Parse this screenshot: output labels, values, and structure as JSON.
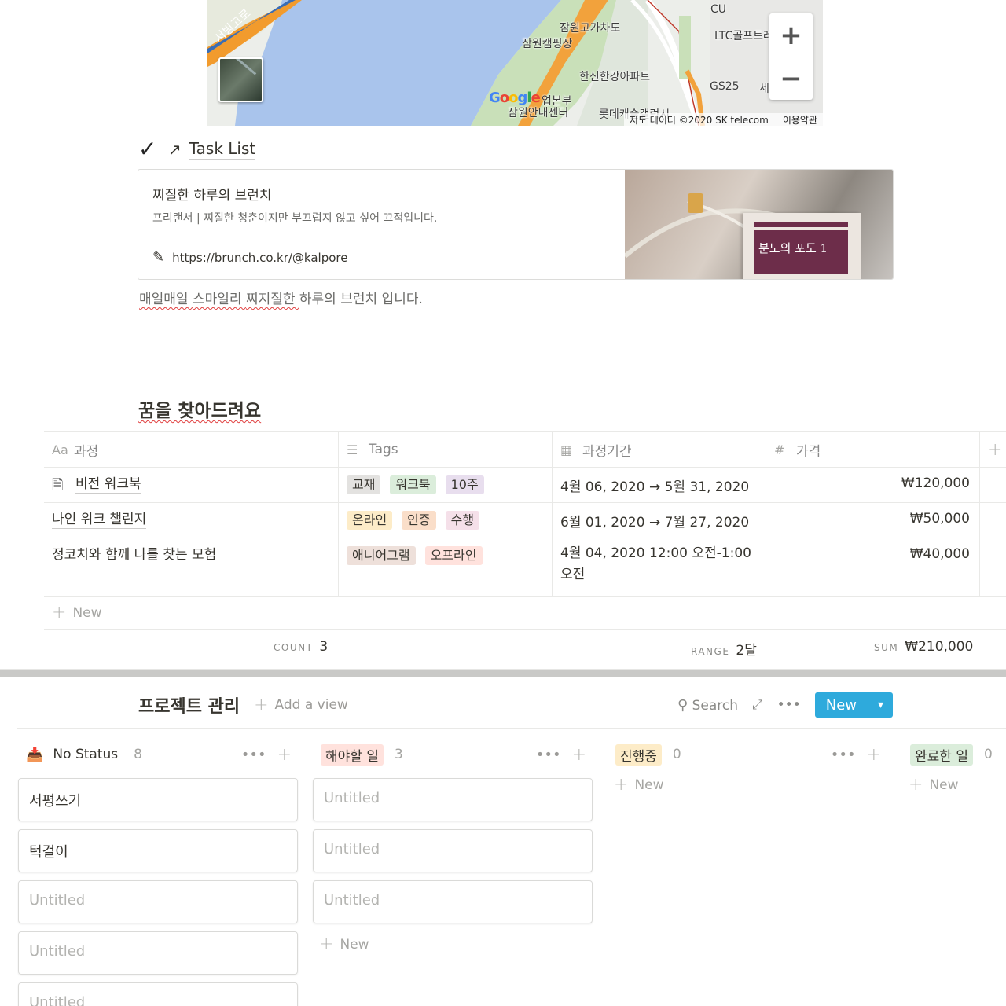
{
  "map": {
    "labels": [
      "CU",
      "잠원고가차도",
      "잠원캠핑장",
      "LTC골프트레",
      "한신한강아파트",
      "GS25",
      "세",
      "업본부",
      "잠원안내센터",
      "롯데캐슬갤럭시"
    ],
    "road_label": "서빙고로",
    "google": [
      "G",
      "o",
      "o",
      "g",
      "l",
      "e"
    ],
    "attribution": "지도 데이터 ©2020 SK telecom",
    "terms": "이용약관",
    "zoom_in": "+",
    "zoom_out": "−"
  },
  "task_link": {
    "check": "✓",
    "arrow": "↗",
    "title": "Task List"
  },
  "bookmark": {
    "title": "찌질한 하루의 브런치",
    "description": "프리랜서 | 찌질한 청춘이지만 부끄럽지 않고 싶어 끄적입니다.",
    "url": "https://brunch.co.kr/@kalpore",
    "book_title": "분노의 포도 1"
  },
  "caption": [
    "매일매일 ",
    "스마일리 ",
    "찌지질한 ",
    "하루의 브런치 입니다."
  ],
  "database": {
    "title": "꿈을 찾아드려요",
    "columns": [
      {
        "icon": "Aa",
        "label": "과정"
      },
      {
        "icon": "☰",
        "label": "Tags"
      },
      {
        "icon": "▦",
        "label": "과정기간"
      },
      {
        "icon": "#",
        "label": "가격"
      }
    ],
    "add_col": "+",
    "rows": [
      {
        "name": "비전 워크북",
        "tags": [
          "교재",
          "워크북",
          "10주"
        ],
        "period": "4월 06, 2020 → 5월 31, 2020",
        "price": "₩120,000"
      },
      {
        "name": "나인 위크 챌린지",
        "tags": [
          "온라인",
          "인증",
          "수행"
        ],
        "period": "6월 01, 2020 → 7월 27, 2020",
        "price": "₩50,000"
      },
      {
        "name": "정코치와 함께 나를 찾는 모험",
        "tags": [
          "애니어그램",
          "오프라인"
        ],
        "period": "4월 04, 2020 12:00 오전-1:00 오전",
        "price": "₩40,000"
      }
    ],
    "tag_colors": [
      "#e3e2e0",
      "#dbeddb",
      "#e8deee",
      "#fdecc8",
      "#fadec9",
      "#f5e0e9",
      "#eee0da",
      "#ffe2dd"
    ],
    "new_label": "New",
    "count_label": "COUNT",
    "count_value": "3",
    "range_label": "RANGE",
    "range_value": "2달",
    "sum_label": "SUM",
    "sum_value": "₩210,000"
  },
  "board": {
    "title": "프로젝트 관리",
    "add_view": "Add a view",
    "search": "Search",
    "new_button": "New",
    "columns": [
      {
        "label": "No Status",
        "count": "8",
        "color": "transparent",
        "cards": [
          "서평쓰기",
          "턱걸이",
          "Untitled",
          "Untitled",
          "Untitled"
        ]
      },
      {
        "label": "해야할 일",
        "count": "3",
        "color": "#ffe2dd",
        "cards": [
          "Untitled",
          "Untitled",
          "Untitled"
        ]
      },
      {
        "label": "진행중",
        "count": "0",
        "color": "#fdecc8",
        "cards": []
      },
      {
        "label": "완료한 일",
        "count": "0",
        "color": "#dbeddb",
        "cards": []
      }
    ],
    "col_new": "New"
  }
}
